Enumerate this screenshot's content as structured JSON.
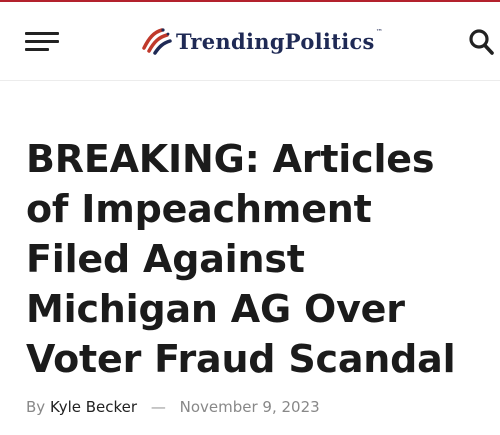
{
  "header": {
    "brand": "TrendingPolitics",
    "trademark": "™",
    "icons": {
      "menu": "hamburger-menu-icon",
      "logo": "flag-stripes-logo-icon",
      "search": "search-icon"
    },
    "colors": {
      "accent_top_bar": "#b3212d",
      "brand_navy": "#1f2a55",
      "brand_red": "#c0392b"
    }
  },
  "article": {
    "title": "BREAKING: Articles of Impeachment Filed Against Michigan AG Over Voter Fraud Scandal",
    "byline_prefix": "By",
    "author": "Kyle Becker",
    "separator": "—",
    "date": "November 9, 2023"
  }
}
